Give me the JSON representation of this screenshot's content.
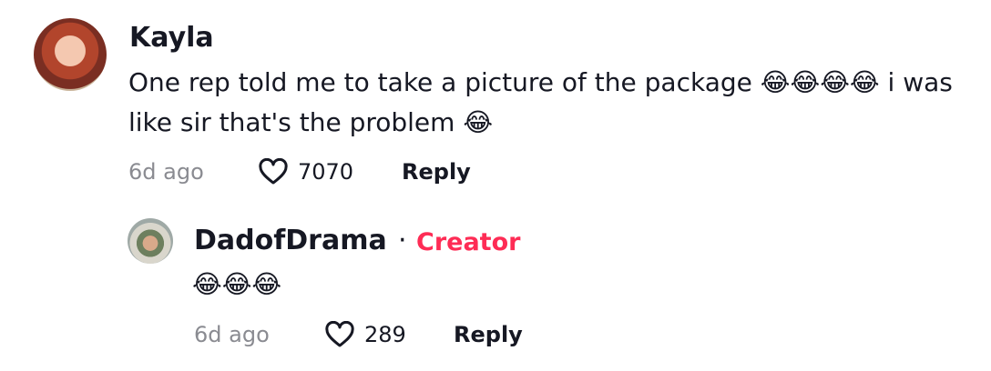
{
  "comment": {
    "username": "Kayla",
    "text": "One rep told me to take a picture of the package 😂😂😂😂 i was like sir that's the problem 😂",
    "time": "6d ago",
    "likes": "7070",
    "reply_label": "Reply",
    "avatar_icon": "user-avatar-photo"
  },
  "reply": {
    "username": "DadofDrama",
    "separator": "·",
    "badge": "Creator",
    "badge_color": "#fe2c55",
    "text": "😂😂😂",
    "time": "6d ago",
    "likes": "289",
    "reply_label": "Reply",
    "avatar_icon": "user-avatar-photo"
  },
  "icons": {
    "like": "heart-outline-icon"
  }
}
